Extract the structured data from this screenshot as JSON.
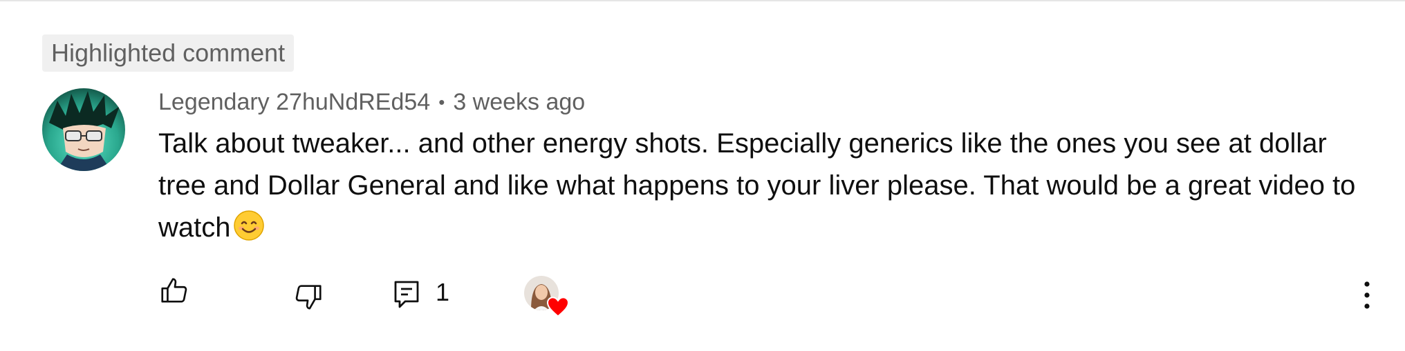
{
  "badge": {
    "label": "Highlighted comment"
  },
  "comment": {
    "author": "Legendary 27huNdREd54",
    "separator": "•",
    "time": "3 weeks ago",
    "text": "Talk about tweaker... and other energy shots. Especially generics like the ones you see at dollar tree and Dollar General and like what happens to your liver please. That would be a great video to watch",
    "emoji": "smiling-face-with-smiling-eyes"
  },
  "actions": {
    "like_icon": "thumbs-up-icon",
    "dislike_icon": "thumbs-down-icon",
    "reply_icon": "comment-reply-icon",
    "reply_count": "1",
    "creator_heart_icon": "heart-icon",
    "more_icon": "more-vertical-icon"
  },
  "colors": {
    "badge_bg": "#f0f0f0",
    "secondary_text": "#606060",
    "primary_text": "#0f0f0f",
    "heart": "#ff0000"
  }
}
